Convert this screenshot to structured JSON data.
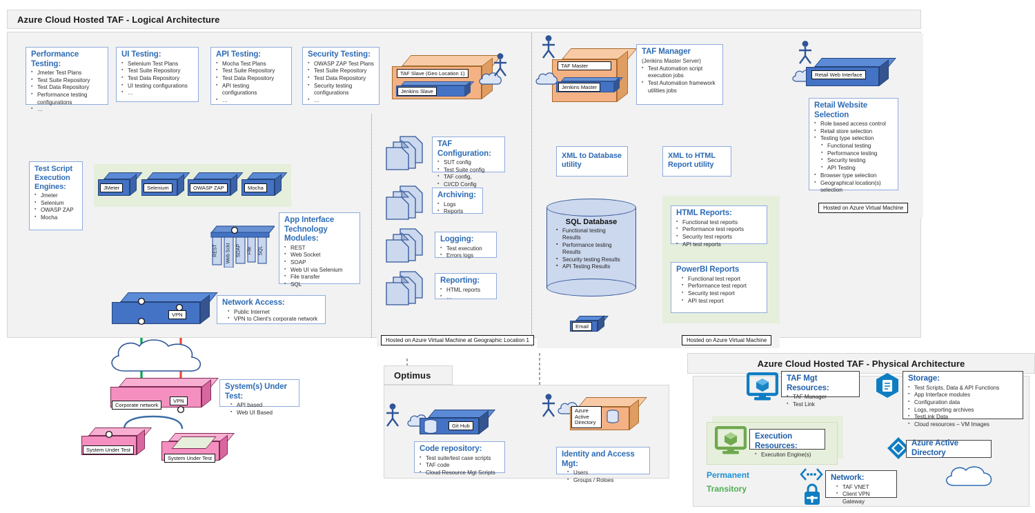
{
  "logical": {
    "title": "Azure Cloud Hosted TAF  - Logical Architecture",
    "test_types": [
      {
        "title": "Performance Testing:",
        "items": [
          "Jmeter Test Plans",
          "Test Suite Repository",
          "Test Data Repository",
          "Performance testing",
          "configurations",
          "…"
        ]
      },
      {
        "title": "UI Testing:",
        "items": [
          "Selenium Test Plans",
          "Test Suite Repository",
          "Test Data Repository",
          "UI testing configurations",
          "…"
        ]
      },
      {
        "title": "API Testing:",
        "items": [
          "Mocha Test Plans",
          "Test Suite Repository",
          "Test Data Repository",
          "API testing",
          "configurations",
          "…"
        ]
      },
      {
        "title": "Security Testing:",
        "items": [
          "OWASP ZAP Test Plans",
          "Test Suite Repository",
          "Test Data Repository",
          "Security testing",
          "configurations",
          "…"
        ]
      }
    ],
    "engines_card": {
      "title": "Test Script Execution Engines:",
      "items": [
        "Jmeter",
        "Selenium",
        "OWASP ZAP",
        "Mocha"
      ]
    },
    "engines": [
      "JMeter",
      "Selenium",
      "OWASP ZAP",
      "Mocha"
    ],
    "app_interface": {
      "title": "App Interface Technology Modules:",
      "items": [
        "REST",
        "Web Socket",
        "SOAP",
        "Web UI via Selenium",
        "File transfer",
        "SQL"
      ],
      "tabs": [
        "REST",
        "Web Sckt",
        "SOAP",
        "File",
        "SQL"
      ]
    },
    "network_access": {
      "title": "Network Access:",
      "items": [
        "Public Internet",
        "VPN to Client's corporate network"
      ]
    },
    "network_vpn_tag": "VPN",
    "sut_card": {
      "title": "System(s) Under Test:",
      "items": [
        "API based",
        "Web UI Based"
      ]
    },
    "corporate_network_tag": "Corporate network",
    "sut_vpn_tag": "VPN",
    "sut_tags": [
      "System Under Test",
      "System Under Test"
    ],
    "taf_slave_tag": "TAF Slave (Geo Location 1)",
    "jenkins_slave_tag": "Jenkins Slave",
    "taf_master_tag": "TAF Master",
    "jenkins_master_tag": "Jenkins Master",
    "taf_manager": {
      "title": "TAF Manager",
      "sub": "(Jenkins Master Server)",
      "items": [
        "Test Automation script",
        "execution jobs",
        "Test Automation framework",
        "utilities jobs"
      ]
    },
    "doc_cards": [
      {
        "title": "TAF Configuration:",
        "items": [
          "SUT config",
          "Test Suite config",
          "TAF config,",
          "CI/CD Config"
        ]
      },
      {
        "title": "Archiving:",
        "items": [
          "Logs",
          "Reports"
        ]
      },
      {
        "title": "Logging:",
        "items": [
          "Test execution",
          "Errors logs"
        ]
      },
      {
        "title": "Reporting:",
        "items": [
          "HTML reports",
          "…"
        ]
      }
    ],
    "xml_db_utility": "XML to Database utility",
    "xml_html_utility": "XML to HTML Report utility",
    "sql_database": {
      "title": "SQL Database",
      "items": [
        "Functional testing",
        "Results",
        "Performance testing",
        "Results",
        "Security testing Results",
        "API Testing Results"
      ]
    },
    "email_tag": "Email",
    "html_reports": {
      "title": "HTML Reports:",
      "items": [
        "Functional test reports",
        "Performance test reports",
        "Security test reports",
        "API test reports"
      ]
    },
    "powerbi_reports": {
      "title": "PowerBI Reports",
      "items": [
        "Functional test report",
        "Performance test report",
        "Security test report",
        "API test report"
      ]
    },
    "retail_web_tag": "Retail Web Interface",
    "retail_selection": {
      "title": "Retail Website Selection",
      "items": [
        "Role based access control",
        "Retail store selection",
        "Testing type selection"
      ],
      "sub_items": [
        "Functional testing",
        "Performance testing",
        "Security testing",
        "API Testing"
      ],
      "items_after": [
        "Browser type selection",
        "Geographical location(s)",
        "selection"
      ]
    },
    "host_labels": {
      "geo1": "Hosted on Azure Virtual Machine at Geographic Location 1",
      "vm_center": "Hosted on Azure Virtual Machine",
      "vm_right": "Hosted on Azure Virtual Machine"
    }
  },
  "optimus": {
    "title": "Optimus",
    "git_tag": "Git Hub",
    "code_repo": {
      "title": "Code repository:",
      "items": [
        "Test suite/test case scripts",
        "TAF code",
        "Cloud Resource Mgt Scripts"
      ]
    },
    "aad_tag": "Azure\nActive\nDirectory",
    "aad_tag_lines": [
      "Azure",
      "Active",
      "Directory"
    ],
    "identity": {
      "title": "Identity and Access Mgt:",
      "items": [
        "Users",
        "Groups / Roloes"
      ]
    }
  },
  "physical": {
    "title": "Azure Cloud Hosted TAF  - Physical Architecture",
    "taf_mgt": {
      "title": "TAF Mgt Resources:",
      "items": [
        "TAF Manager",
        "Test Link"
      ]
    },
    "execution": {
      "title": "Execution Resources:",
      "items": [
        "Execution Engine(s)"
      ]
    },
    "storage": {
      "title": "Storage:",
      "items": [
        "Test Scripts, Data & API Functions",
        "App Interface modules",
        "Configuration data",
        "Logs, reporting archives",
        "TestLink Data",
        "Cloud resources – VM Images"
      ]
    },
    "aad_label": "Azure Active Directory",
    "network": {
      "title": "Network:",
      "items": [
        "TAF VNET",
        "Client VPN Gateway"
      ]
    },
    "legend": {
      "permanent": "Permanent",
      "transitory": "Transitory"
    }
  },
  "colors": {
    "panel_bg": "#f2f2f2",
    "accent_blue": "#2e6cb5",
    "link_blue": "#29ABE2",
    "box_blue": "#4472C4",
    "box_orange": "#F4B183",
    "box_pink": "#F48FC0",
    "green_zone": "#e6efdc",
    "azure_blue": "#0f7dc2",
    "green_accent": "#6fa84f"
  }
}
